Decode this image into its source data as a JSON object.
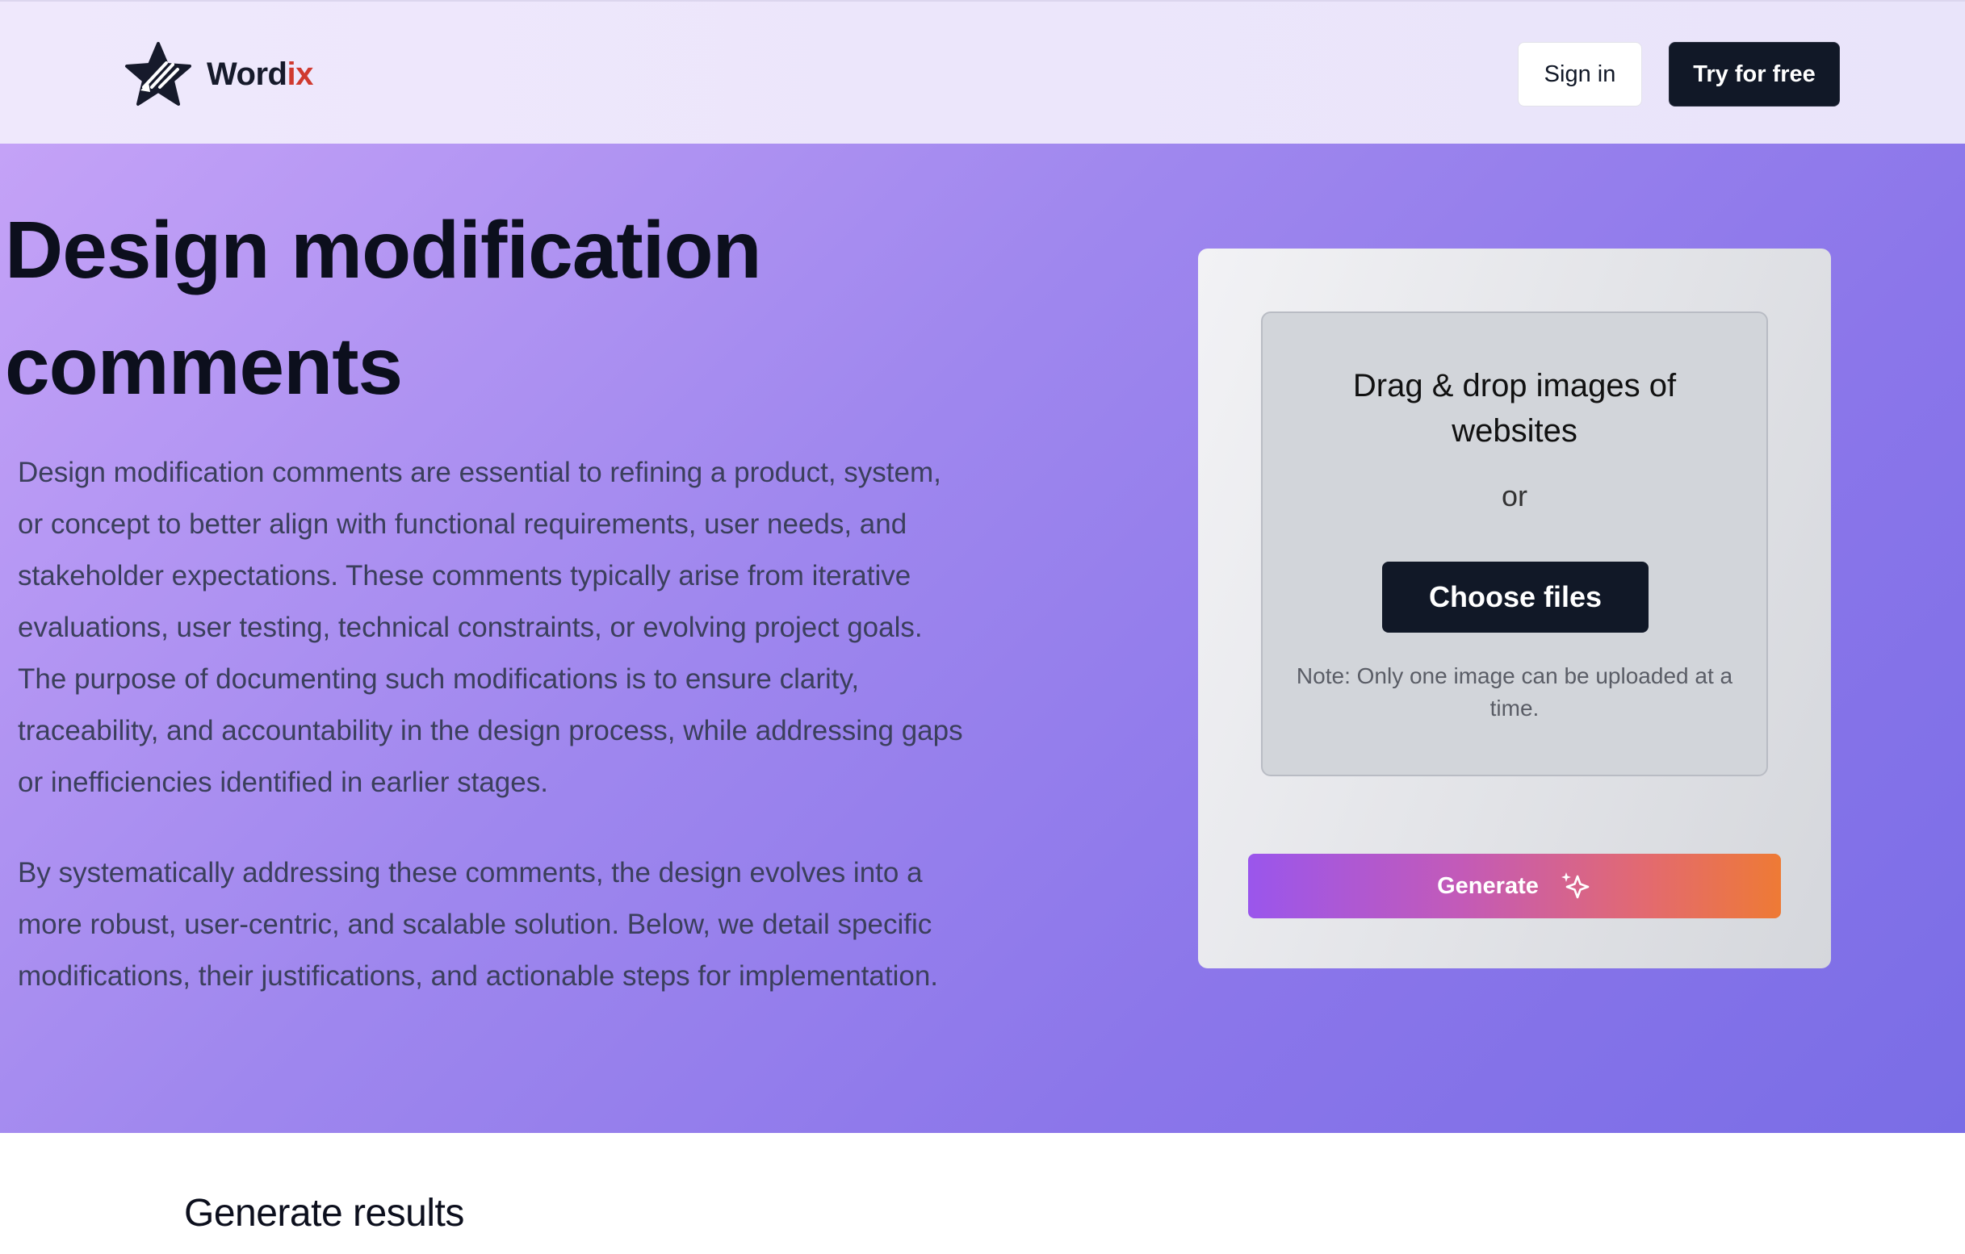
{
  "header": {
    "brand": {
      "name_main": "Word",
      "name_accent": "ix",
      "logo_icon": "star-pen-logo-icon"
    },
    "signin_label": "Sign in",
    "try_label": "Try for free"
  },
  "hero": {
    "title_line1": "Design modification",
    "title_line2": "comments",
    "paragraph1": "Design modification comments are essential to refining a product, system, or concept to better align with functional requirements, user needs, and stakeholder expectations. These comments typically arise from iterative evaluations, user testing, technical constraints, or evolving project goals. The purpose of documenting such modifications is to ensure clarity, traceability, and accountability in the design process, while addressing gaps or inefficiencies identified in earlier stages.",
    "paragraph2": "By systematically addressing these comments, the design evolves into a more robust, user-centric, and scalable solution. Below, we detail specific modifications, their justifications, and actionable steps for implementation."
  },
  "upload": {
    "drop_title": "Drag & drop images of websites",
    "or_label": "or",
    "choose_label": "Choose files",
    "note": "Note: Only one image can be uploaded at a time.",
    "generate_label": "Generate",
    "generate_icon": "sparkle-icon"
  },
  "results": {
    "title": "Generate results"
  },
  "colors": {
    "accent_brand": "#d03a2f",
    "dark_button": "#111827",
    "generate_gradient_start": "#9a56ec",
    "generate_gradient_end": "#ee7a35",
    "hero_gradient_start": "#c4a2f7",
    "hero_gradient_end": "#7a6de6"
  }
}
